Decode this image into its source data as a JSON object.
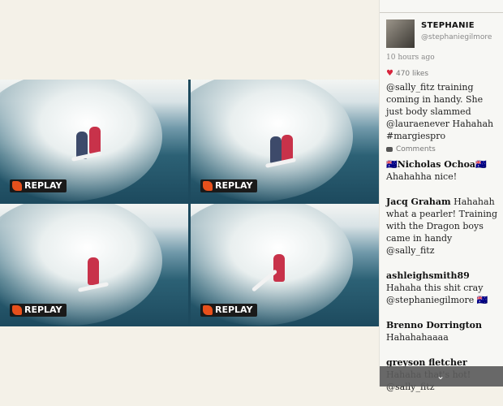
{
  "photo": {
    "panels": [
      {
        "label": "REPLAY"
      },
      {
        "label": "REPLAY"
      },
      {
        "label": "REPLAY"
      },
      {
        "label": "REPLAY"
      }
    ]
  },
  "sidebar": {
    "username": "STEPHANIE",
    "handle": "@stephaniegilmore",
    "time": "10 hours ago",
    "likes": "470 likes",
    "caption": "@sally_fitz training coming in handy. She just body slammed @lauraenever Hahahah #margiespro",
    "comments_header": "Comments",
    "comments": [
      {
        "name": "🇦🇺Nicholas Ochoa🇦🇺",
        "text": "Ahahahha nice!"
      },
      {
        "name": "Jacq Graham",
        "text": "Hahahah what a pearler! Training with the Dragon boys came in handy @sally_fitz"
      },
      {
        "name": "ashleighsmith89",
        "text": "Hahaha this shit cray @stephaniegilmore 🇦🇺"
      },
      {
        "name": "Brenno Dorrington",
        "text": "Hahahahaaaa"
      },
      {
        "name": "greyson fletcher",
        "text": "Hahaha that's hot! @sally_fitz"
      }
    ]
  },
  "colors": {
    "accent": "#d8243c",
    "replay_orange": "#e8501c",
    "sidebar_bg": "#f7f7f4"
  },
  "icons": {
    "heart": "heart-icon",
    "comment": "comment-bubble-icon",
    "chevron": "chevron-down-icon"
  }
}
